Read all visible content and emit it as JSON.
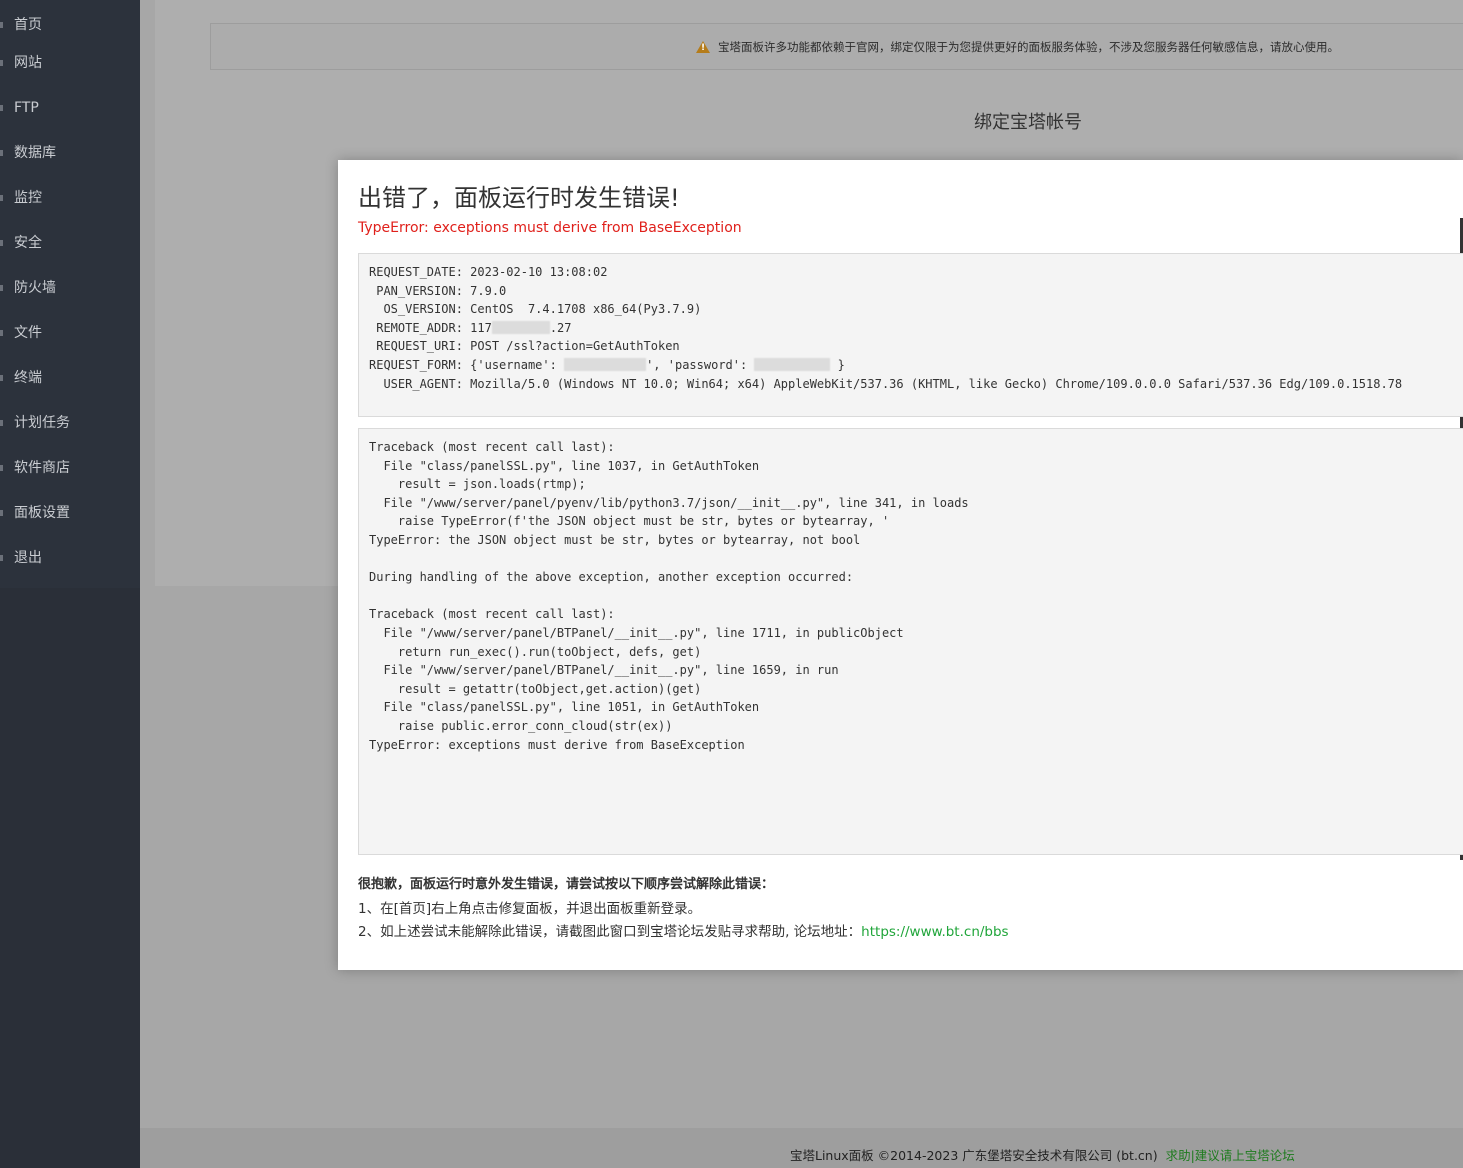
{
  "sidebar": {
    "items": [
      {
        "label": "首页"
      },
      {
        "label": "网站"
      },
      {
        "label": "FTP"
      },
      {
        "label": "数据库"
      },
      {
        "label": "监控"
      },
      {
        "label": "安全"
      },
      {
        "label": "防火墙"
      },
      {
        "label": "文件"
      },
      {
        "label": "终端"
      },
      {
        "label": "计划任务"
      },
      {
        "label": "软件商店"
      },
      {
        "label": "面板设置"
      },
      {
        "label": "退出"
      }
    ]
  },
  "background": {
    "notice": "宝塔面板许多功能都依赖于官网，绑定仅限于为您提供更好的面板服务体验，不涉及您服务器任何敏感信息，请放心使用。",
    "bind_title": "绑定宝塔帐号"
  },
  "dialog": {
    "title": "出错了，面板运行时发生错误!",
    "error_summary": "TypeError: exceptions must derive from BaseException",
    "request_info": {
      "request_date": "REQUEST_DATE: 2023-02-10 13:08:02",
      "pan_version": " PAN_VERSION: 7.9.0",
      "os_version": "  OS_VERSION: CentOS  7.4.1708 x86_64(Py3.7.9)",
      "remote_addr_prefix": " REMOTE_ADDR: 117",
      "remote_addr_suffix": ".27",
      "request_uri": " REQUEST_URI: POST /ssl?action=GetAuthToken",
      "request_form_a": "REQUEST_FORM: {'username': ",
      "request_form_b": "', 'password': ",
      "request_form_c": " }",
      "user_agent": "  USER_AGENT: Mozilla/5.0 (Windows NT 10.0; Win64; x64) AppleWebKit/537.36 (KHTML, like Gecko) Chrome/109.0.0.0 Safari/537.36 Edg/109.0.1518.78"
    },
    "traceback": [
      "Traceback (most recent call last):",
      "  File \"class/panelSSL.py\", line 1037, in GetAuthToken",
      "    result = json.loads(rtmp);",
      "  File \"/www/server/panel/pyenv/lib/python3.7/json/__init__.py\", line 341, in loads",
      "    raise TypeError(f'the JSON object must be str, bytes or bytearray, '",
      "TypeError: the JSON object must be str, bytes or bytearray, not bool",
      "",
      "During handling of the above exception, another exception occurred:",
      "",
      "Traceback (most recent call last):",
      "  File \"/www/server/panel/BTPanel/__init__.py\", line 1711, in publicObject",
      "    return run_exec().run(toObject, defs, get)",
      "  File \"/www/server/panel/BTPanel/__init__.py\", line 1659, in run",
      "    result = getattr(toObject,get.action)(get)",
      "  File \"class/panelSSL.py\", line 1051, in GetAuthToken",
      "    raise public.error_conn_cloud(str(ex))",
      "TypeError: exceptions must derive from BaseException"
    ],
    "help_heading": "很抱歉，面板运行时意外发生错误，请尝试按以下顺序尝试解除此错误：",
    "help_step1": "1、在[首页]右上角点击修复面板，并退出面板重新登录。",
    "help_step2_text": "2、如上述尝试未能解除此错误，请截图此窗口到宝塔论坛发贴寻求帮助, 论坛地址：",
    "help_step2_link": "https://www.bt.cn/bbs"
  },
  "footer": {
    "copyright": "宝塔Linux面板 ©2014-2023 广东堡塔安全技术有限公司 (bt.cn)",
    "help_link": "求助|建议请上宝塔论坛"
  },
  "colors": {
    "sidebar_bg": "#2c323c",
    "error_red": "#e0201b",
    "link_green": "#20a53a"
  }
}
